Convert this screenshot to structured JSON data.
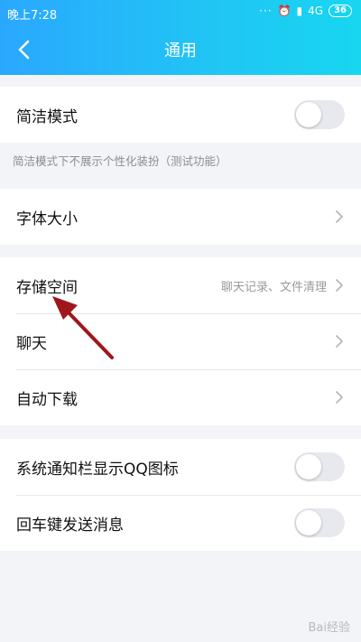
{
  "status_bar": {
    "time": "晚上7:28",
    "network": "4G",
    "battery": "36"
  },
  "nav": {
    "title": "通用",
    "back_icon": "back-chevron-icon"
  },
  "settings": {
    "simple_mode": {
      "label": "简洁模式",
      "enabled": false,
      "note": "简洁模式下不展示个性化装扮（测试功能）"
    },
    "font_size": {
      "label": "字体大小"
    },
    "storage": {
      "label": "存储空间",
      "hint": "聊天记录、文件清理"
    },
    "chat": {
      "label": "聊天"
    },
    "auto_download": {
      "label": "自动下载"
    },
    "show_qq_icon": {
      "label": "系统通知栏显示QQ图标",
      "enabled": false
    },
    "enter_to_send": {
      "label": "回车键发送消息",
      "enabled": false
    }
  },
  "colors": {
    "header_start": "#2aa8ff",
    "header_end": "#18d6f0",
    "annotation_arrow": "#a0171b"
  },
  "watermark": "Bai经验"
}
